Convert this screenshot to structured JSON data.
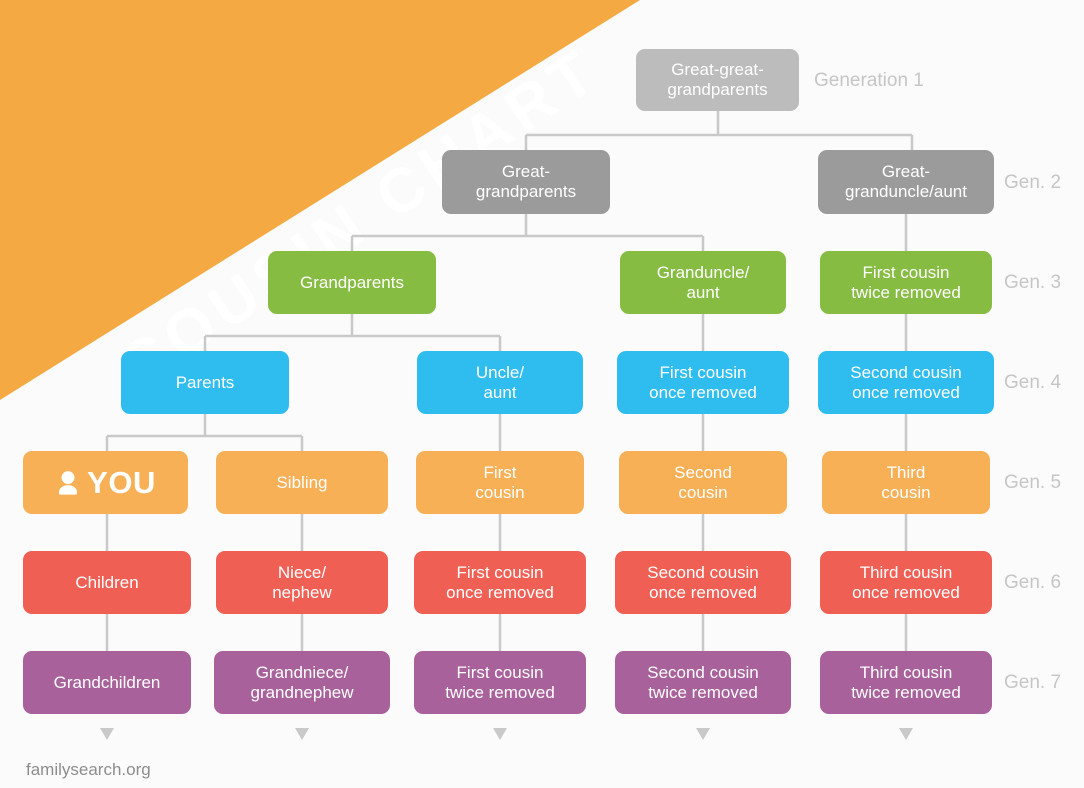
{
  "banner": {
    "title": "COUSIN CHART",
    "color": "#f5a943"
  },
  "footer": {
    "text": "familysearch.org"
  },
  "palette": {
    "gen1": "#bcbcbc",
    "gen2": "#9b9b9b",
    "gen3": "#86bc41",
    "gen4": "#2ebdee",
    "gen5": "#f7b055",
    "gen6": "#ef5f54",
    "gen7": "#a8619a",
    "connector": "#c9c9c9",
    "gen_label": "#c6c6c6",
    "footer_text": "#8d8d8d",
    "background": "#fbfbfb"
  },
  "generations": [
    {
      "id": "gen1",
      "label": "Generation 1",
      "color": "#bcbcbc"
    },
    {
      "id": "gen2",
      "label": "Gen. 2",
      "color": "#9b9b9b"
    },
    {
      "id": "gen3",
      "label": "Gen. 3",
      "color": "#86bc41"
    },
    {
      "id": "gen4",
      "label": "Gen. 4",
      "color": "#2ebdee"
    },
    {
      "id": "gen5",
      "label": "Gen. 5",
      "color": "#f7b055"
    },
    {
      "id": "gen6",
      "label": "Gen. 6",
      "color": "#ef5f54"
    },
    {
      "id": "gen7",
      "label": "Gen. 7",
      "color": "#a8619a"
    }
  ],
  "nodes": {
    "g1_c3": "Great-great-\ngrandparents",
    "g2_c2": "Great-\ngrandparents",
    "g2_c5": "Great-\ngranduncle/aunt",
    "g3_c1": "Grandparents",
    "g3_c4": "Granduncle/\naunt",
    "g3_c5": "First cousin\ntwice removed",
    "g4_c1": "Parents",
    "g4_c2": "Uncle/\naunt",
    "g4_c3": "First cousin\nonce removed",
    "g4_c4": "Second cousin\nonce removed",
    "g5_c1": "YOU",
    "g5_c2": "Sibling",
    "g5_c3": "First\ncousin",
    "g5_c4": "Second\ncousin",
    "g5_c5": "Third\ncousin",
    "g6_c1": "Children",
    "g6_c2": "Niece/\nnephew",
    "g6_c3": "First cousin\nonce removed",
    "g6_c4": "Second cousin\nonce removed",
    "g6_c5": "Third cousin\nonce removed",
    "g7_c1": "Grandchildren",
    "g7_c2": "Grandniece/\ngrandnephew",
    "g7_c3": "First cousin\ntwice removed",
    "g7_c4": "Second cousin\ntwice removed",
    "g7_c5": "Third cousin\ntwice removed"
  },
  "icons": {
    "you_person": "person-icon"
  }
}
